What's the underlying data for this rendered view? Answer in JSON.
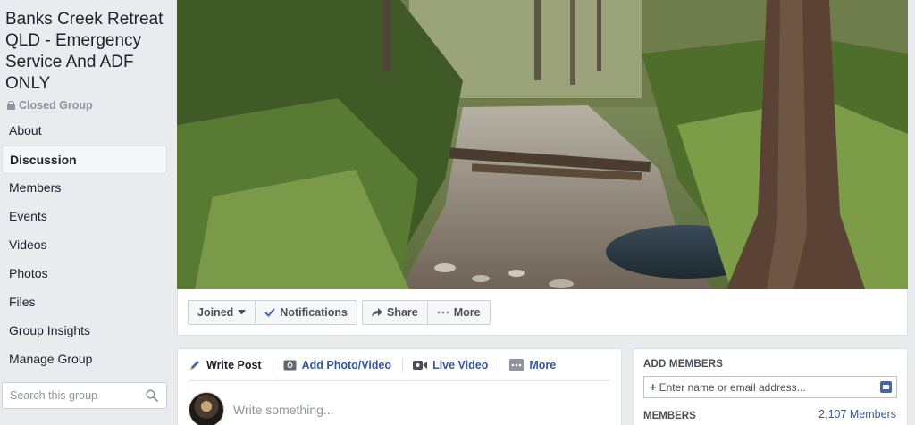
{
  "group": {
    "title": "Banks Creek Retreat QLD - Emergency Service And ADF ONLY",
    "privacy": "Closed Group"
  },
  "sidebar": {
    "items": [
      {
        "label": "About"
      },
      {
        "label": "Discussion",
        "active": true
      },
      {
        "label": "Members"
      },
      {
        "label": "Events"
      },
      {
        "label": "Videos"
      },
      {
        "label": "Photos"
      },
      {
        "label": "Files"
      },
      {
        "label": "Group Insights"
      },
      {
        "label": "Manage Group"
      }
    ],
    "search_placeholder": "Search this group"
  },
  "actions": {
    "joined": "Joined",
    "notifications": "Notifications",
    "share": "Share",
    "more": "More"
  },
  "composer": {
    "tabs": {
      "write_post": "Write Post",
      "add_photo_video": "Add Photo/Video",
      "live_video": "Live Video",
      "more": "More"
    },
    "placeholder": "Write something..."
  },
  "add_members": {
    "heading": "ADD MEMBERS",
    "input_placeholder": "Enter name or email address...",
    "members_label": "MEMBERS",
    "members_count": "2,107 Members"
  },
  "colors": {
    "link": "#365899",
    "background": "#e9ebee",
    "accent": "#4267b2"
  }
}
